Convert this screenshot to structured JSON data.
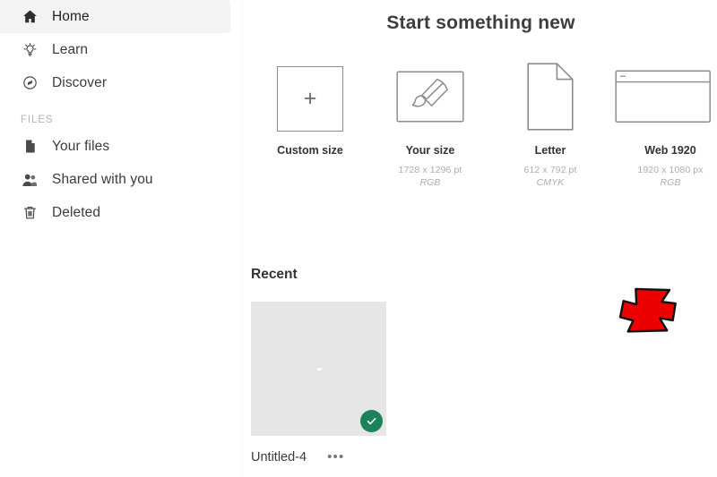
{
  "app": {
    "title": "Start something new"
  },
  "sidebar": {
    "items": [
      {
        "label": "Home",
        "icon": "home-icon",
        "active": true
      },
      {
        "label": "Learn",
        "icon": "lightbulb-icon",
        "active": false
      },
      {
        "label": "Discover",
        "icon": "compass-icon",
        "active": false
      }
    ],
    "section_label": "FILES",
    "file_items": [
      {
        "label": "Your files",
        "icon": "document-icon"
      },
      {
        "label": "Shared with you",
        "icon": "people-icon"
      },
      {
        "label": "Deleted",
        "icon": "trash-icon"
      }
    ]
  },
  "presets": [
    {
      "name": "Custom size",
      "dims": "",
      "mode": "",
      "icon": "plus-square-icon",
      "plus": "+"
    },
    {
      "name": "Your size",
      "dims": "1728 x 1296 pt",
      "mode": "RGB",
      "icon": "paintbrush-canvas-icon"
    },
    {
      "name": "Letter",
      "dims": "612 x 792 pt",
      "mode": "CMYK",
      "icon": "page-document-icon"
    },
    {
      "name": "Web 1920",
      "dims": "1920 x 1080 px",
      "mode": "RGB",
      "icon": "browser-window-icon"
    }
  ],
  "recent": {
    "heading": "Recent",
    "files": [
      {
        "name": "Untitled-4",
        "more_label": "•••",
        "status": "cloud-synced",
        "badge_icon": "check-circle-icon"
      }
    ]
  },
  "overlay": {
    "annotation_icon": "red-arrow-pointer"
  },
  "colors": {
    "accent_green": "#1a8359",
    "annotation_red": "#ee0000",
    "thumb_gray": "#e6e6e6",
    "active_nav": "#f3f3f3"
  }
}
